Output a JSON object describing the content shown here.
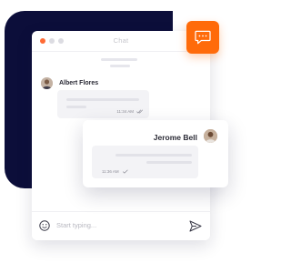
{
  "colors": {
    "navy": "#0c0e3a",
    "accent": "#ff6b0a",
    "window_dot": "#ff6b35"
  },
  "window": {
    "title": "Chat"
  },
  "messages": [
    {
      "sender": "Albert Flores",
      "time": "11:34 AM",
      "icon": "double-check-icon"
    },
    {
      "sender": "Jerome Bell",
      "time": "11:36 AM",
      "icon": "check-icon"
    }
  ],
  "composer": {
    "placeholder": "Start typing...",
    "emoji_icon": "smiley-icon",
    "send_icon": "paper-plane-icon"
  },
  "fab": {
    "icon": "chat-bubble-icon"
  }
}
